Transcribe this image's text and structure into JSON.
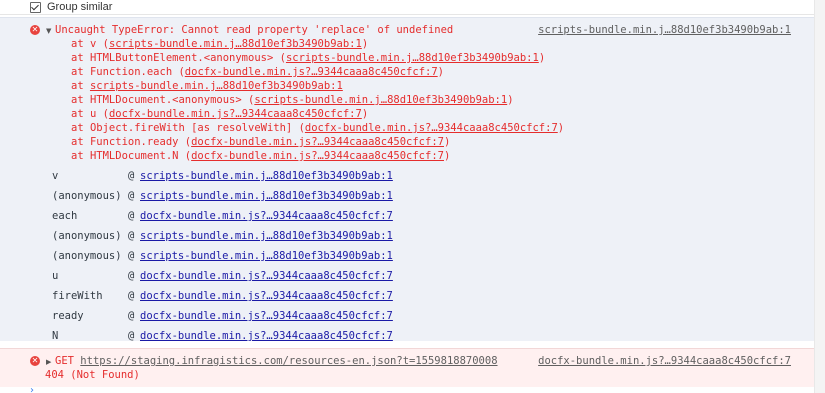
{
  "toolbar": {
    "group_similar_label": "Group similar",
    "group_similar_checked": true
  },
  "error": {
    "icon": "error-circle-icon",
    "message": "Uncaught TypeError: Cannot read property 'replace' of undefined",
    "source": "scripts-bundle.min.j…88d10ef3b3490b9ab:1",
    "trace": [
      {
        "prefix": "at v (",
        "link": "scripts-bundle.min.j…88d10ef3b3490b9ab:1",
        "suffix": ")"
      },
      {
        "prefix": "at HTMLButtonElement.<anonymous> (",
        "link": "scripts-bundle.min.j…88d10ef3b3490b9ab:1",
        "suffix": ")"
      },
      {
        "prefix": "at Function.each (",
        "link": "docfx-bundle.min.js?…9344caaa8c450cfcf:7",
        "suffix": ")"
      },
      {
        "prefix": "at ",
        "link": "scripts-bundle.min.j…88d10ef3b3490b9ab:1",
        "suffix": ""
      },
      {
        "prefix": "at HTMLDocument.<anonymous> (",
        "link": "scripts-bundle.min.j…88d10ef3b3490b9ab:1",
        "suffix": ")"
      },
      {
        "prefix": "at u (",
        "link": "docfx-bundle.min.js?…9344caaa8c450cfcf:7",
        "suffix": ")"
      },
      {
        "prefix": "at Object.fireWith [as resolveWith] (",
        "link": "docfx-bundle.min.js?…9344caaa8c450cfcf:7",
        "suffix": ")"
      },
      {
        "prefix": "at Function.ready (",
        "link": "docfx-bundle.min.js?…9344caaa8c450cfcf:7",
        "suffix": ")"
      },
      {
        "prefix": "at HTMLDocument.N (",
        "link": "docfx-bundle.min.js?…9344caaa8c450cfcf:7",
        "suffix": ")"
      }
    ],
    "stack": [
      {
        "fn": "v",
        "link": "scripts-bundle.min.j…88d10ef3b3490b9ab:1"
      },
      {
        "fn": "(anonymous)",
        "link": "scripts-bundle.min.j…88d10ef3b3490b9ab:1"
      },
      {
        "fn": "each",
        "link": "docfx-bundle.min.js?…9344caaa8c450cfcf:7"
      },
      {
        "fn": "(anonymous)",
        "link": "scripts-bundle.min.j…88d10ef3b3490b9ab:1"
      },
      {
        "fn": "(anonymous)",
        "link": "scripts-bundle.min.j…88d10ef3b3490b9ab:1"
      },
      {
        "fn": "u",
        "link": "docfx-bundle.min.js?…9344caaa8c450cfcf:7"
      },
      {
        "fn": "fireWith",
        "link": "docfx-bundle.min.js?…9344caaa8c450cfcf:7"
      },
      {
        "fn": "ready",
        "link": "docfx-bundle.min.js?…9344caaa8c450cfcf:7"
      },
      {
        "fn": "N",
        "link": "docfx-bundle.min.js?…9344caaa8c450cfcf:7"
      }
    ],
    "at_symbol": "@"
  },
  "network_error": {
    "icon": "error-circle-icon",
    "method": "GET",
    "url": "https://staging.infragistics.com/resources-en.json?t=1559818870008",
    "source": "docfx-bundle.min.js?…9344caaa8c450cfcf:7",
    "status": "404 (Not Found)"
  },
  "prompt": {
    "icon": "prompt-chevron-icon",
    "glyph": "›"
  },
  "colors": {
    "error_text": "#e52d2d",
    "link_blue": "#1a1aa6",
    "entry_bg": "#eef1f7",
    "error_bg": "#fff0f0",
    "prompt_blue": "#367cf1"
  }
}
